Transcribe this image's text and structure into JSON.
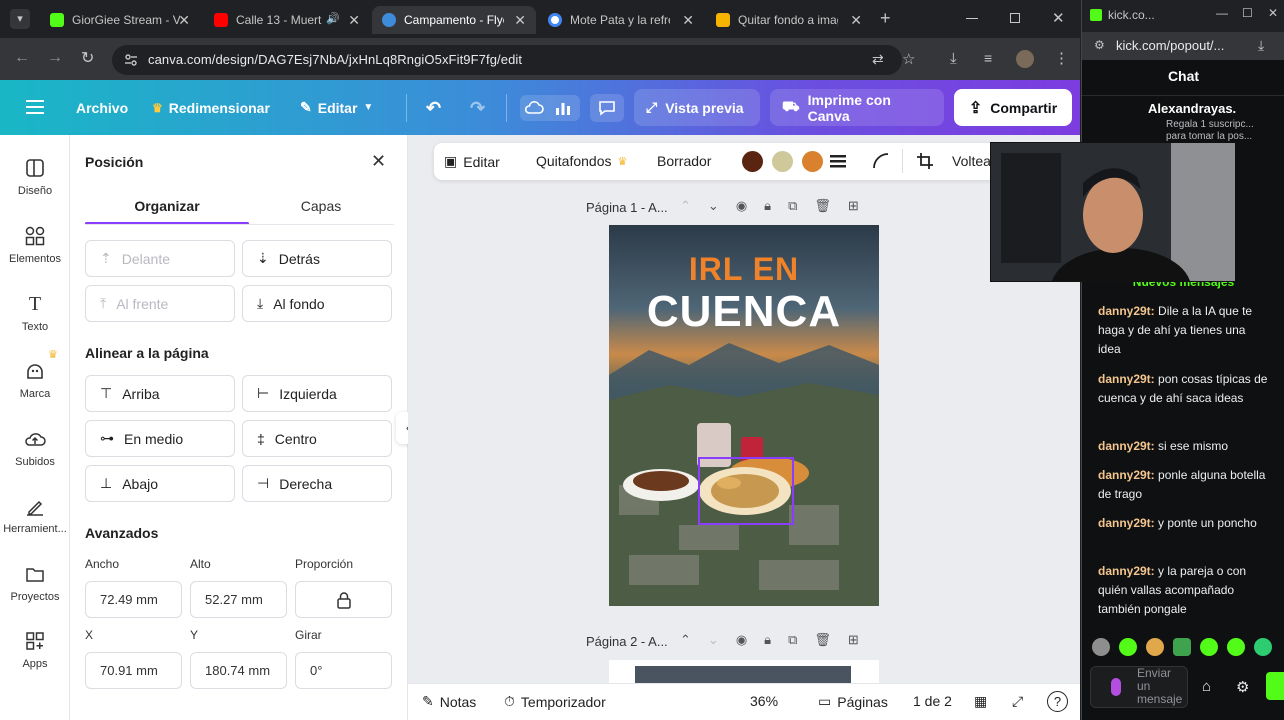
{
  "browser": {
    "tabs": [
      {
        "title": "GiorGiee Stream - V",
        "favicon_color": "#53fc18",
        "active": false
      },
      {
        "title": "Calle 13 - Muert",
        "favicon_color": "#ff0000",
        "active": false
      },
      {
        "title": "Campamento - Flye",
        "favicon_color": "#3c8cd9",
        "active": true
      },
      {
        "title": "Mote Pata y la refre",
        "favicon_color": "#4285f4",
        "active": false
      },
      {
        "title": "Quitar fondo a imag",
        "favicon_color": "#f4b400",
        "active": false
      }
    ],
    "url": "canva.com/design/DAG7Esj7NbA/jxHnLq8RngiO5xFit9F7fg/edit"
  },
  "canva_toolbar": {
    "archivo": "Archivo",
    "redimensionar": "Redimensionar",
    "editar": "Editar",
    "vista_previa": "Vista previa",
    "imprime": "Imprime con Canva",
    "compartir": "Compartir"
  },
  "rail": [
    "Diseño",
    "Elementos",
    "Texto",
    "Marca",
    "Subidos",
    "Herramient...",
    "Proyectos",
    "Apps"
  ],
  "panel": {
    "title": "Posición",
    "tabs": [
      "Organizar",
      "Capas"
    ],
    "order_buttons": [
      "Delante",
      "Detrás",
      "Al frente",
      "Al fondo"
    ],
    "align_title": "Alinear a la página",
    "align_buttons": [
      "Arriba",
      "Izquierda",
      "En medio",
      "Centro",
      "Abajo",
      "Derecha"
    ],
    "advanced_title": "Avanzados",
    "labels": {
      "ancho": "Ancho",
      "alto": "Alto",
      "proporcion": "Proporción",
      "x": "X",
      "y": "Y",
      "girar": "Girar"
    },
    "values": {
      "ancho": "72.49 mm",
      "alto": "52.27 mm",
      "x": "70.91 mm",
      "y": "180.74 mm",
      "girar": "0°"
    }
  },
  "context_toolbar": {
    "editar": "Editar",
    "quitafondos": "Quitafondos",
    "borrador": "Borrador",
    "voltear": "Voltea",
    "colors": [
      "#5a2410",
      "#cfc89a",
      "#d9812e"
    ]
  },
  "page1_label": "Página 1 - A...",
  "page2_label": "Página 2 - A...",
  "poster": {
    "line1": "IRL EN",
    "line2": "CUENCA"
  },
  "bottom": {
    "notas": "Notas",
    "temporizador": "Temporizador",
    "zoom": "36%",
    "paginas": "Páginas",
    "count": "1 de 2"
  },
  "popout": {
    "url": "kick.com/popout/...",
    "window_title": "kick.co...",
    "chat_title": "Chat",
    "top_user": "Alexandrayas.",
    "top_sub": "Regala 1 suscripc... para tomar la pos...",
    "new_messages": "Nuevos mensajes",
    "input_placeholder": "Enviar un mensaje",
    "messages": [
      {
        "user": "danny29t:",
        "text": "Dile a la IA que te haga y de ahí ya tienes una idea"
      },
      {
        "user": "danny29t:",
        "text": "pon cosas típicas de cuenca y de ahí saca ideas"
      },
      {
        "user": "danny29t:",
        "text": "si ese mismo"
      },
      {
        "user": "danny29t:",
        "text": "ponle alguna botella de trago"
      },
      {
        "user": "danny29t:",
        "text": "y ponte un poncho"
      },
      {
        "user": "danny29t:",
        "text": "y la pareja o con quién vallas acompañado también pongale"
      }
    ]
  }
}
